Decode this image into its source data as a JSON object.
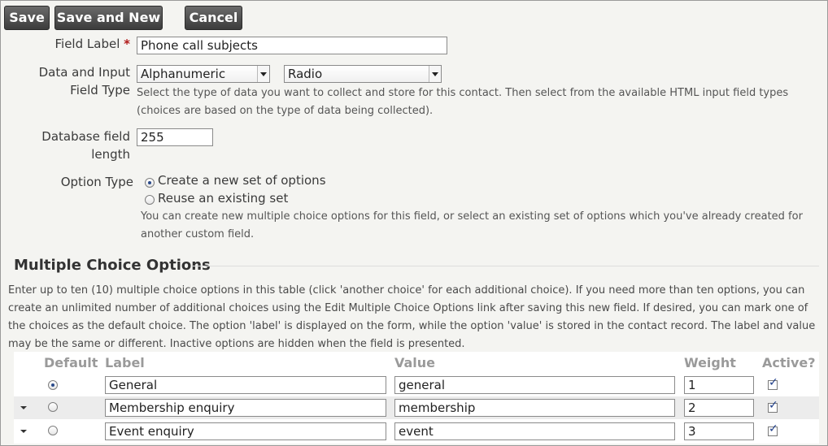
{
  "toolbar": {
    "save_label": "Save",
    "save_new_label": "Save and New",
    "cancel_label": "Cancel"
  },
  "field_label": {
    "label": "Field Label",
    "required_mark": "*",
    "value": "Phone call subjects"
  },
  "data_type": {
    "label_line1": "Data and Input",
    "label_line2": "Field Type",
    "data_value": "Alphanumeric",
    "input_value": "Radio",
    "help_line1": "Select the type of data you want to collect and store for this contact. Then select from the available HTML input field types",
    "help_line2": "(choices are based on the type of data being collected)."
  },
  "db_length": {
    "label_line1": "Database field",
    "label_line2": "length",
    "value": "255"
  },
  "option_type": {
    "label": "Option Type",
    "option_new": "Create a new set of options",
    "option_reuse": "Reuse an existing set",
    "selected": "new",
    "help_line1": "You can create new multiple choice options for this field, or select an existing set of options which you've already created for",
    "help_line2": "another custom field."
  },
  "mc_section": {
    "title": "Multiple Choice Options",
    "para_line1": "Enter up to ten (10) multiple choice options in this table (click 'another choice' for each additional choice). If you need more than ten options, you can",
    "para_line2": "create an unlimited number of additional choices using the Edit Multiple Choice Options link after saving this new field. If desired, you can mark one of",
    "para_line3": "the choices as the default choice. The option 'label' is displayed on the form, while the option 'value' is stored in the contact record. The label and value",
    "para_line4": "may be the same or different. Inactive options are hidden when the field is presented."
  },
  "options_table": {
    "headers": {
      "default": "Default",
      "label": "Label",
      "value": "Value",
      "weight": "Weight",
      "active": "Active?"
    },
    "rows": [
      {
        "label": "General",
        "value": "general",
        "weight": "1",
        "default": true,
        "active": true
      },
      {
        "label": "Membership enquiry",
        "value": "membership",
        "weight": "2",
        "default": false,
        "active": true
      },
      {
        "label": "Event enquiry",
        "value": "event",
        "weight": "3",
        "default": false,
        "active": true
      }
    ]
  },
  "colors": {
    "button_bg": "#4a4a4a",
    "required": "#b01818",
    "header_text": "#9a9a9a",
    "row_alt": "#ececec"
  }
}
